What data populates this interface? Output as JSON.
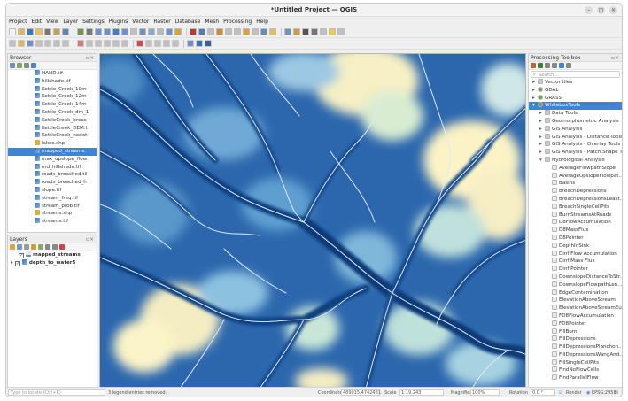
{
  "window": {
    "title": "*Untitled Project — QGIS",
    "controls": [
      "–",
      "□",
      "×"
    ]
  },
  "menu": [
    "Project",
    "Edit",
    "View",
    "Layer",
    "Settings",
    "Plugins",
    "Vector",
    "Raster",
    "Database",
    "Mesh",
    "Processing",
    "Help"
  ],
  "browser": {
    "title": "Browser",
    "items": [
      {
        "label": "HAND.tif",
        "selected": false
      },
      {
        "label": "hillshade.tif",
        "selected": false
      },
      {
        "label": "Kettle_Creek_10m",
        "selected": false
      },
      {
        "label": "Kettle_Creek_12m",
        "selected": false
      },
      {
        "label": "Kettle_Creek_14m",
        "selected": false
      },
      {
        "label": "Kettle_Creek_dm_1",
        "selected": false
      },
      {
        "label": "KettleCreek_breac",
        "selected": false
      },
      {
        "label": "KettleCreek_DEM.t",
        "selected": false
      },
      {
        "label": "KettleCreek_nodat",
        "selected": false
      },
      {
        "label": "lakes.shp",
        "selected": false
      },
      {
        "label": "mapped_streams.",
        "selected": true
      },
      {
        "label": "max_upslope_flow",
        "selected": false
      },
      {
        "label": "md_hillshade.tif",
        "selected": false
      },
      {
        "label": "roads_breached.til",
        "selected": false
      },
      {
        "label": "roads_breached_h",
        "selected": false
      },
      {
        "label": "slope.tif",
        "selected": false
      },
      {
        "label": "stream_freq.tif",
        "selected": false
      },
      {
        "label": "stream_prob.tif",
        "selected": false
      },
      {
        "label": "streams.shp",
        "selected": false
      },
      {
        "label": "streams.tif",
        "selected": false
      }
    ]
  },
  "layers": {
    "title": "Layers",
    "items": [
      {
        "label": "mapped_streams",
        "checked": true
      },
      {
        "label": "depth_to_water5",
        "checked": true
      }
    ]
  },
  "toolbox": {
    "title": "Processing Toolbox",
    "search_placeholder": "Search...",
    "items": [
      {
        "label": "Vector tiles",
        "level": 1,
        "kind": "group",
        "selected": false
      },
      {
        "label": "GDAL",
        "level": 1,
        "kind": "provider",
        "selected": false
      },
      {
        "label": "GRASS",
        "level": 1,
        "kind": "provider",
        "selected": false
      },
      {
        "label": "WhiteboxTools",
        "level": 1,
        "kind": "provider",
        "selected": true
      },
      {
        "label": "Data Tools",
        "level": 2,
        "kind": "group",
        "selected": false
      },
      {
        "label": "Geomorphometric Analysis",
        "level": 2,
        "kind": "group",
        "selected": false
      },
      {
        "label": "GIS Analysis",
        "level": 2,
        "kind": "group",
        "selected": false
      },
      {
        "label": "GIS Analysis - Distance Tools",
        "level": 2,
        "kind": "group",
        "selected": false
      },
      {
        "label": "GIS Analysis - Overlay Tools",
        "level": 2,
        "kind": "group",
        "selected": false
      },
      {
        "label": "GIS Analysis - Patch Shape Tools",
        "level": 2,
        "kind": "group",
        "selected": false
      },
      {
        "label": "Hydrological Analysis",
        "level": 2,
        "kind": "group-open",
        "selected": false
      },
      {
        "label": "AverageFlowpathSlope",
        "level": 3,
        "kind": "tool",
        "selected": false
      },
      {
        "label": "AverageUpslopeFlowpat...",
        "level": 3,
        "kind": "tool",
        "selected": false
      },
      {
        "label": "Basins",
        "level": 3,
        "kind": "tool",
        "selected": false
      },
      {
        "label": "BreachDepressions",
        "level": 3,
        "kind": "tool",
        "selected": false
      },
      {
        "label": "BreachDepressionsLeast...",
        "level": 3,
        "kind": "tool",
        "selected": false
      },
      {
        "label": "BreachSingleCellPits",
        "level": 3,
        "kind": "tool",
        "selected": false
      },
      {
        "label": "BurnStreamsAtRoads",
        "level": 3,
        "kind": "tool",
        "selected": false
      },
      {
        "label": "D8FlowAccumulation",
        "level": 3,
        "kind": "tool",
        "selected": false
      },
      {
        "label": "D8MassFlux",
        "level": 3,
        "kind": "tool",
        "selected": false
      },
      {
        "label": "D8Pointer",
        "level": 3,
        "kind": "tool",
        "selected": false
      },
      {
        "label": "DepthInSink",
        "level": 3,
        "kind": "tool",
        "selected": false
      },
      {
        "label": "Dinf Flow Accumulation",
        "level": 3,
        "kind": "tool",
        "selected": false
      },
      {
        "label": "Dinf Mass Flux",
        "level": 3,
        "kind": "tool",
        "selected": false
      },
      {
        "label": "Dinf Pointer",
        "level": 3,
        "kind": "tool",
        "selected": false
      },
      {
        "label": "DownslopeDistanceToStr...",
        "level": 3,
        "kind": "tool",
        "selected": false
      },
      {
        "label": "DownslopeFlowpathLen...",
        "level": 3,
        "kind": "tool",
        "selected": false
      },
      {
        "label": "EdgeContamination",
        "level": 3,
        "kind": "tool",
        "selected": false
      },
      {
        "label": "ElevationAboveStream",
        "level": 3,
        "kind": "tool",
        "selected": false
      },
      {
        "label": "ElevationAboveStreamEu...",
        "level": 3,
        "kind": "tool",
        "selected": false
      },
      {
        "label": "FD8FlowAccumulation",
        "level": 3,
        "kind": "tool",
        "selected": false
      },
      {
        "label": "FD8Pointer",
        "level": 3,
        "kind": "tool",
        "selected": false
      },
      {
        "label": "FillBurn",
        "level": 3,
        "kind": "tool",
        "selected": false
      },
      {
        "label": "FillDepressions",
        "level": 3,
        "kind": "tool",
        "selected": false
      },
      {
        "label": "FillDepressionsPlanchon...",
        "level": 3,
        "kind": "tool",
        "selected": false
      },
      {
        "label": "FillDepressionsWangAnd...",
        "level": 3,
        "kind": "tool",
        "selected": false
      },
      {
        "label": "FillSingleCellPits",
        "level": 3,
        "kind": "tool",
        "selected": false
      },
      {
        "label": "FindNoFlowCells",
        "level": 3,
        "kind": "tool",
        "selected": false
      },
      {
        "label": "FindParallelFlow",
        "level": 3,
        "kind": "tool",
        "selected": false
      }
    ]
  },
  "status": {
    "locate_placeholder": "Type to locate (Ctrl+K)",
    "message": "3 legend entries removed.",
    "coordinate_label": "Coordinate",
    "coordinate_value": "489015,4742481",
    "scale_label": "Scale",
    "scale_value": "1:19,243",
    "magnifier_label": "Magnifier",
    "magnifier_value": "100%",
    "rotation_label": "Rotation",
    "rotation_value": "0.0 °",
    "render_label": "Render",
    "crs": "EPSG:2958"
  },
  "colors": {
    "accent": "#3b86d6",
    "map_deep": "#0c3f80",
    "map_light": "#fff6c9"
  }
}
